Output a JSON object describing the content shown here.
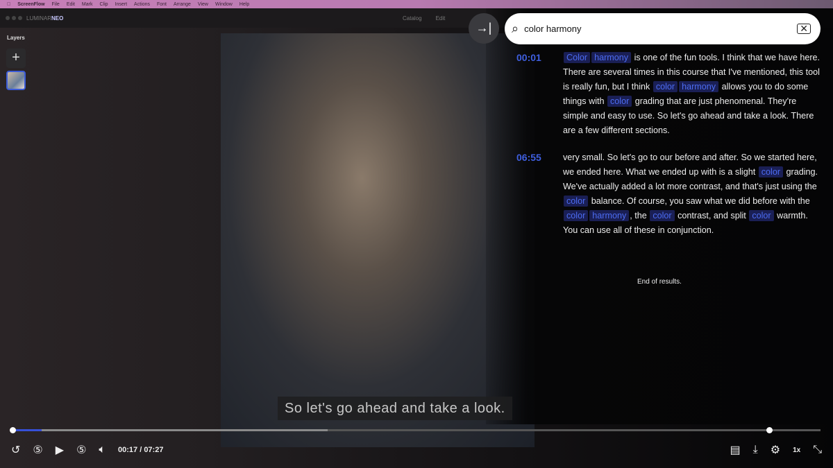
{
  "menubar": {
    "apple": "",
    "app": "ScreenFlow",
    "items": [
      "File",
      "Edit",
      "Mark",
      "Clip",
      "Insert",
      "Actions",
      "Font",
      "Arrange",
      "View",
      "Window",
      "Help"
    ]
  },
  "appbar": {
    "brand": "LUMINAR",
    "brand_accent": "NEO",
    "catalog": "Catalog",
    "edit": "Edit"
  },
  "sidebar": {
    "title": "Layers",
    "add": "+"
  },
  "search": {
    "value": "color harmony",
    "back_icon": "→|",
    "search_icon": "⌕",
    "clear_icon": "✕"
  },
  "results": [
    {
      "time": "00:01",
      "segments": [
        {
          "t": "Color",
          "hl": true
        },
        {
          "t": "harmony",
          "hl": true
        },
        {
          "t": " is one of the fun tools. I think that we have here. There are several times in this course that I've mentioned, this tool is really fun, but I think "
        },
        {
          "t": "color",
          "hl": true
        },
        {
          "t": "harmony",
          "hl": true
        },
        {
          "t": " allows you to do some things with "
        },
        {
          "t": "color",
          "hl": true
        },
        {
          "t": " grading that are just phenomenal. They're simple and easy to use. So let's go ahead and take a look. There are a few different sections."
        }
      ]
    },
    {
      "time": "06:55",
      "segments": [
        {
          "t": "very small. So let's go to our before and after. So we started here, we ended here. What we ended up with is a slight "
        },
        {
          "t": "color",
          "hl": true
        },
        {
          "t": " grading. We've actually added a lot more contrast, and that's just using the "
        },
        {
          "t": "color",
          "hl": true
        },
        {
          "t": " balance. Of course, you saw what we did before with the "
        },
        {
          "t": "color",
          "hl": true
        },
        {
          "t": "harmony",
          "hl": true
        },
        {
          "t": ", the "
        },
        {
          "t": "color",
          "hl": true
        },
        {
          "t": " contrast, and split "
        },
        {
          "t": "color",
          "hl": true
        },
        {
          "t": " warmth. You can use all of these in conjunction."
        }
      ]
    }
  ],
  "end_text": "End of results.",
  "subtitle": "So let's go ahead and take a look.",
  "player": {
    "progress_percent": 3.6,
    "buffered_percent": 39,
    "current": "00:17",
    "duration": "07:27",
    "time_display": "00:17 / 07:27",
    "speed": "1x",
    "highlight_color": "#4c6cf2",
    "accent": "#3650d8"
  }
}
